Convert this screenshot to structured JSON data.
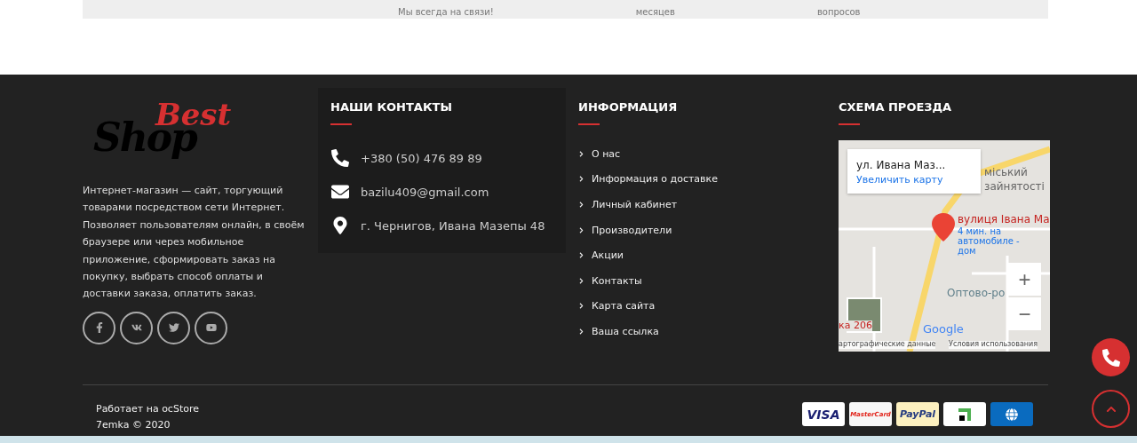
{
  "features": [
    "Мы всегда на связи!",
    "месяцев",
    "вопросов"
  ],
  "about": {
    "logo_top": "Best",
    "logo_bottom": "Shop",
    "text": "Интернет-магазин — сайт, торгующий товарами посредством сети Интернет. Позволяет пользователям онлайн, в своём браузере или через мобильное приложение, сформировать заказ на покупку, выбрать способ оплаты и доставки заказа, оплатить заказ.",
    "socials": [
      {
        "kind": "facebook"
      },
      {
        "kind": "vk"
      },
      {
        "kind": "twitter"
      },
      {
        "kind": "youtube"
      }
    ]
  },
  "contacts": {
    "title": "НАШИ КОНТАКТЫ",
    "items": [
      {
        "kind": "phone",
        "text": "+380 (50) 476 89 89"
      },
      {
        "kind": "email",
        "text": "bazilu409@gmail.com"
      },
      {
        "kind": "address",
        "text": "г. Чернигов, Ивана Мазепы 48"
      }
    ]
  },
  "information": {
    "title": "ИНФОРМАЦИЯ",
    "links": [
      "О нас",
      "Информация о доставке",
      "Личный кабинет",
      "Производители",
      "Акции",
      "Контакты",
      "Карта сайта",
      "Ваша ссылка"
    ]
  },
  "map": {
    "title": "СХЕМА ПРОЕЗДА",
    "place": "ул. Ивана Маз...",
    "enlarge": "Увеличить карту",
    "pin_label": "вулиця Івана Ма",
    "route": "4 мин. на автомобиле - дом",
    "poi": "Оптово-ро",
    "poi2": "ка 206",
    "area": "міський",
    "area2": "зайнятості",
    "brand": "Google",
    "zoom_in": "+",
    "zoom_out": "−",
    "attribution": "артографические данные",
    "terms": "Условия использования"
  },
  "bottom": {
    "powered": "Работает на ocStore",
    "copyright": "7emka © 2020",
    "payments": [
      {
        "kind": "visa",
        "label": "VISA"
      },
      {
        "kind": "mastercard",
        "label": "MasterCard"
      },
      {
        "kind": "paypal",
        "label": "PayPal"
      },
      {
        "kind": "privat"
      },
      {
        "kind": "webmoney"
      }
    ]
  }
}
